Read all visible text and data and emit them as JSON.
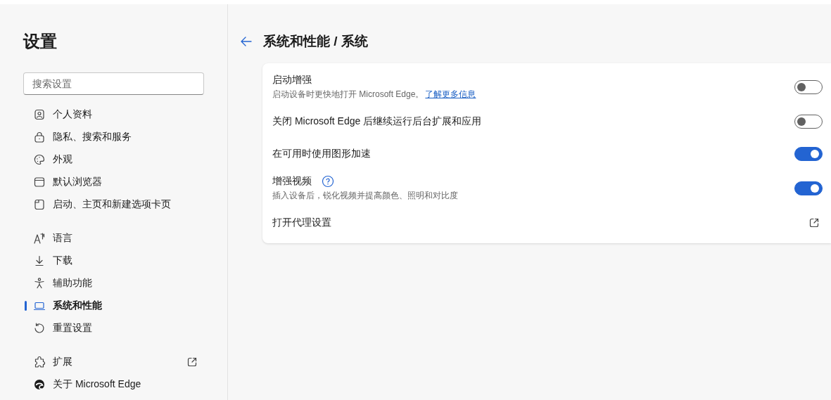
{
  "sidebar": {
    "title": "设置",
    "search": {
      "placeholder": "搜索设置"
    },
    "groups": [
      [
        {
          "label": "个人资料",
          "selected": false
        },
        {
          "label": "隐私、搜索和服务",
          "selected": false
        },
        {
          "label": "外观",
          "selected": false
        },
        {
          "label": "默认浏览器",
          "selected": false
        },
        {
          "label": "启动、主页和新建选项卡页",
          "selected": false
        }
      ],
      [
        {
          "label": "语言",
          "selected": false
        },
        {
          "label": "下载",
          "selected": false
        },
        {
          "label": "辅助功能",
          "selected": false
        },
        {
          "label": "系统和性能",
          "selected": true
        },
        {
          "label": "重置设置",
          "selected": false
        }
      ],
      [
        {
          "label": "扩展",
          "selected": false,
          "external": true
        },
        {
          "label": "关于 Microsoft Edge",
          "selected": false
        }
      ]
    ]
  },
  "page": {
    "title": "系统和性能 / 系统",
    "settings": [
      {
        "kind": "toggle",
        "title": "启动增强",
        "description": "启动设备时更快地打开 Microsoft Edge。",
        "link": "了解更多信息",
        "on": false
      },
      {
        "kind": "toggle",
        "title": "关闭 Microsoft Edge 后继续运行后台扩展和应用",
        "on": false
      },
      {
        "kind": "toggle",
        "title": "在可用时使用图形加速",
        "on": true
      },
      {
        "kind": "toggle",
        "title": "增强视频",
        "description": "插入设备后，锐化视频并提高颜色、照明和对比度",
        "help": true,
        "on": true
      },
      {
        "kind": "external",
        "title": "打开代理设置"
      }
    ]
  }
}
